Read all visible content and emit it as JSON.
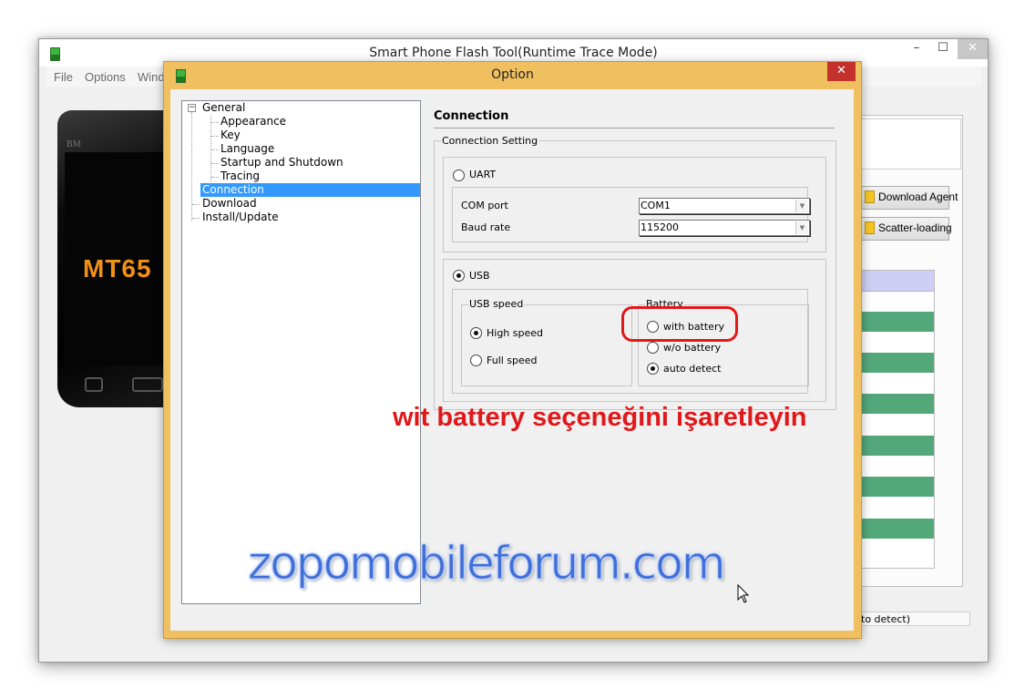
{
  "main_window": {
    "title": "Smart Phone Flash Tool(Runtime Trace Mode)",
    "controls": {
      "minimize": "–",
      "maximize": "☐",
      "close": "✕"
    },
    "menu": [
      "File",
      "Options",
      "Wind"
    ],
    "phone": {
      "brand": "BM",
      "model": "MT65"
    },
    "side_buttons": {
      "download_agent": "Download Agent",
      "scatter_loading": "Scatter-loading"
    },
    "status_text": "to detect)"
  },
  "dialog": {
    "title": "Option",
    "close": "✕",
    "tree": {
      "general": "General",
      "appearance": "Appearance",
      "key": "Key",
      "language": "Language",
      "startup_shutdown": "Startup and Shutdown",
      "tracing": "Tracing",
      "connection": "Connection",
      "download": "Download",
      "install_update": "Install/Update",
      "selected": "Connection"
    },
    "section_title": "Connection",
    "connection_setting": {
      "label": "Connection Setting",
      "uart": {
        "label": "UART",
        "selected": false,
        "com_port_label": "COM port",
        "com_port_value": "COM1",
        "baud_rate_label": "Baud rate",
        "baud_rate_value": "115200"
      },
      "usb": {
        "label": "USB",
        "selected": true,
        "usb_speed": {
          "label": "USB speed",
          "high_speed": "High speed",
          "full_speed": "Full speed",
          "selected": "High speed"
        },
        "battery": {
          "label": "Battery",
          "with_battery": "with battery",
          "wo_battery": "w/o battery",
          "auto_detect": "auto detect",
          "selected": "auto detect"
        }
      }
    }
  },
  "annotation": {
    "caption": "wit battery seçeneğini işaretleyin",
    "caption_color": "#e0181a",
    "watermark": "zopomobileforum.com"
  },
  "colors": {
    "dialog_frame": "#f0c060",
    "selection": "#3399ff",
    "close_button": "#c4302b",
    "list_row_green": "#53a87a"
  }
}
